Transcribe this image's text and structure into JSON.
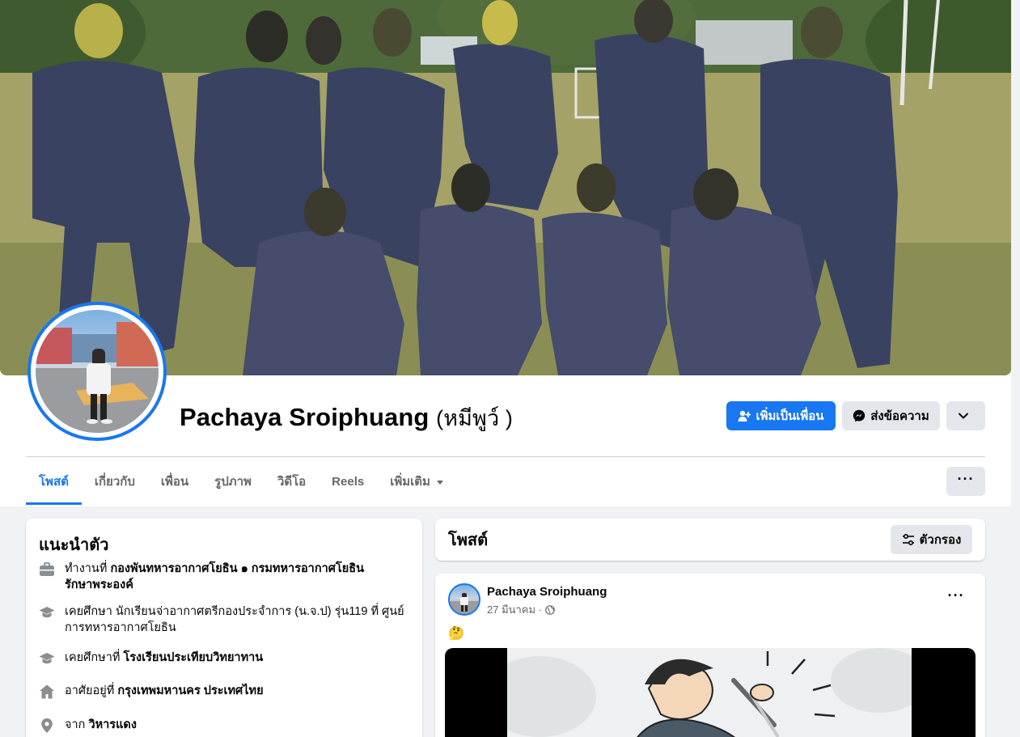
{
  "profile": {
    "name": "Pachaya Sroiphuang",
    "nickname": "(หมีพูว์ )"
  },
  "actions": {
    "add_friend": "เพิ่มเป็นเพื่อน",
    "message": "ส่งข้อความ"
  },
  "tabs": [
    {
      "label": "โพสต์",
      "active": true
    },
    {
      "label": "เกี่ยวกับ",
      "active": false
    },
    {
      "label": "เพื่อน",
      "active": false
    },
    {
      "label": "รูปภาพ",
      "active": false
    },
    {
      "label": "วิดีโอ",
      "active": false
    },
    {
      "label": "Reels",
      "active": false
    },
    {
      "label": "เพิ่มเติม",
      "active": false
    }
  ],
  "more_label": "···",
  "intro": {
    "title": "แนะนำตัว",
    "items": [
      {
        "icon": "briefcase-icon",
        "prefix": "ทำงานที่",
        "line1": "กองพันทหารอากาศโยธิน ๑ กรมทหารอากาศโยธิน",
        "line2": "รักษาพระองค์"
      },
      {
        "icon": "graduation-cap-icon",
        "prefix": "เคยศึกษา",
        "line1": "นักเรียนจ่าอากาศตรีกองประจำการ (น.จ.ป) รุ่น119 ที่ ศูนย์",
        "line2": "การทหารอากาศโยธิน"
      },
      {
        "icon": "graduation-cap-icon",
        "prefix": "เคยศึกษาที่",
        "line1": "โรงเรียนประเทียบวิทยาทาน",
        "line2": ""
      },
      {
        "icon": "home-icon",
        "prefix": "อาศัยอยู่ที่",
        "line1": "กรุงเทพมหานคร ประเทศไทย",
        "line2": ""
      },
      {
        "icon": "location-pin-icon",
        "prefix": "จาก",
        "line1": "วิหารแดง",
        "line2": ""
      }
    ]
  },
  "posts": {
    "title": "โพสต์",
    "filter_label": "ตัวกรอง"
  },
  "post": {
    "author": "Pachaya Sroiphuang",
    "date": "27 มีนาคม ·",
    "emoji": "🤔"
  },
  "colors": {
    "accent": "#1877f2",
    "button_gray": "#e4e6eb",
    "page_bg": "#f0f2f5"
  }
}
